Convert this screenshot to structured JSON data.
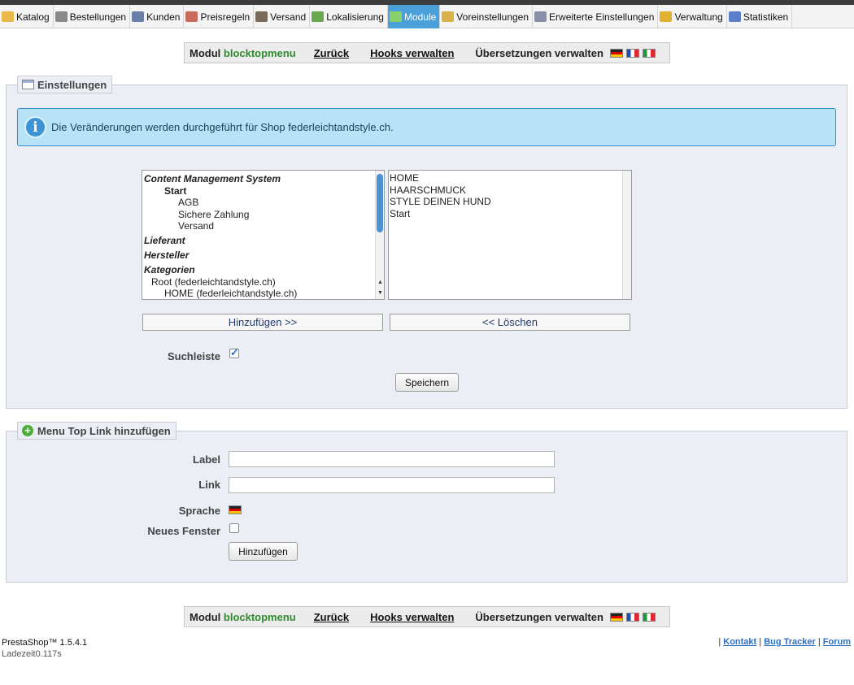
{
  "tabs": [
    {
      "label": "Katalog",
      "icon": "folder-icon",
      "color": "#e9b84a"
    },
    {
      "label": "Bestellungen",
      "icon": "cart-icon",
      "color": "#8a8a8a"
    },
    {
      "label": "Kunden",
      "icon": "user-icon",
      "color": "#6a7fa8"
    },
    {
      "label": "Preisregeln",
      "icon": "price-rule-icon",
      "color": "#c96b5a"
    },
    {
      "label": "Versand",
      "icon": "truck-icon",
      "color": "#7a6a5a"
    },
    {
      "label": "Lokalisierung",
      "icon": "globe-icon",
      "color": "#6aa84f"
    },
    {
      "label": "Module",
      "icon": "puzzle-icon",
      "color": "#8ad06a",
      "active": true
    },
    {
      "label": "Voreinstellungen",
      "icon": "preferences-icon",
      "color": "#d9b24a"
    },
    {
      "label": "Erweiterte Einstellungen",
      "icon": "wrench-icon",
      "color": "#8a8fa8"
    },
    {
      "label": "Verwaltung",
      "icon": "key-icon",
      "color": "#e0b030"
    },
    {
      "label": "Statistiken",
      "icon": "bar-chart-icon",
      "color": "#5a7fc8"
    }
  ],
  "modbar": {
    "prefix": "Modul",
    "module_name": "blocktopmenu",
    "back": "Zurück",
    "hooks": "Hooks verwalten",
    "translations": "Übersetzungen verwalten"
  },
  "settings": {
    "legend": "Einstellungen",
    "info": "Die Veränderungen werden durchgeführt für Shop federleichtandstyle.ch.",
    "available_items": [
      {
        "text": "Content Management System",
        "style": "group",
        "indent": 0
      },
      {
        "text": "Start",
        "style": "bold",
        "indent": 2
      },
      {
        "text": "AGB",
        "style": "normal",
        "indent": 3
      },
      {
        "text": "Sichere Zahlung",
        "style": "normal",
        "indent": 3
      },
      {
        "text": "Versand",
        "style": "normal",
        "indent": 3
      },
      {
        "text": "Lieferant",
        "style": "group",
        "indent": 0
      },
      {
        "text": "Hersteller",
        "style": "group",
        "indent": 0
      },
      {
        "text": "Kategorien",
        "style": "group",
        "indent": 0
      },
      {
        "text": "Root (federleichtandstyle.ch)",
        "style": "normal",
        "indent": 1
      },
      {
        "text": "HOME (federleichtandstyle.ch)",
        "style": "normal",
        "indent": 2
      }
    ],
    "selected_items": [
      "HOME",
      "HAARSCHMUCK",
      "STYLE DEINEN HUND",
      "Start"
    ],
    "add_button": "Hinzufügen >>",
    "remove_button": "<< Löschen",
    "search_label": "Suchleiste",
    "search_checked": true,
    "save_button": "Speichern"
  },
  "add_link": {
    "legend": "Menu Top Link hinzufügen",
    "label_label": "Label",
    "link_label": "Link",
    "language_label": "Sprache",
    "new_window_label": "Neues Fenster",
    "new_window_checked": false,
    "add_button": "Hinzufügen",
    "label_value": "",
    "link_value": ""
  },
  "footer": {
    "version": "PrestaShop™ 1.5.4.1",
    "load_time": "Ladezeit0.117s",
    "contact": "Kontakt",
    "bug_tracker": "Bug Tracker",
    "forum": "Forum"
  }
}
